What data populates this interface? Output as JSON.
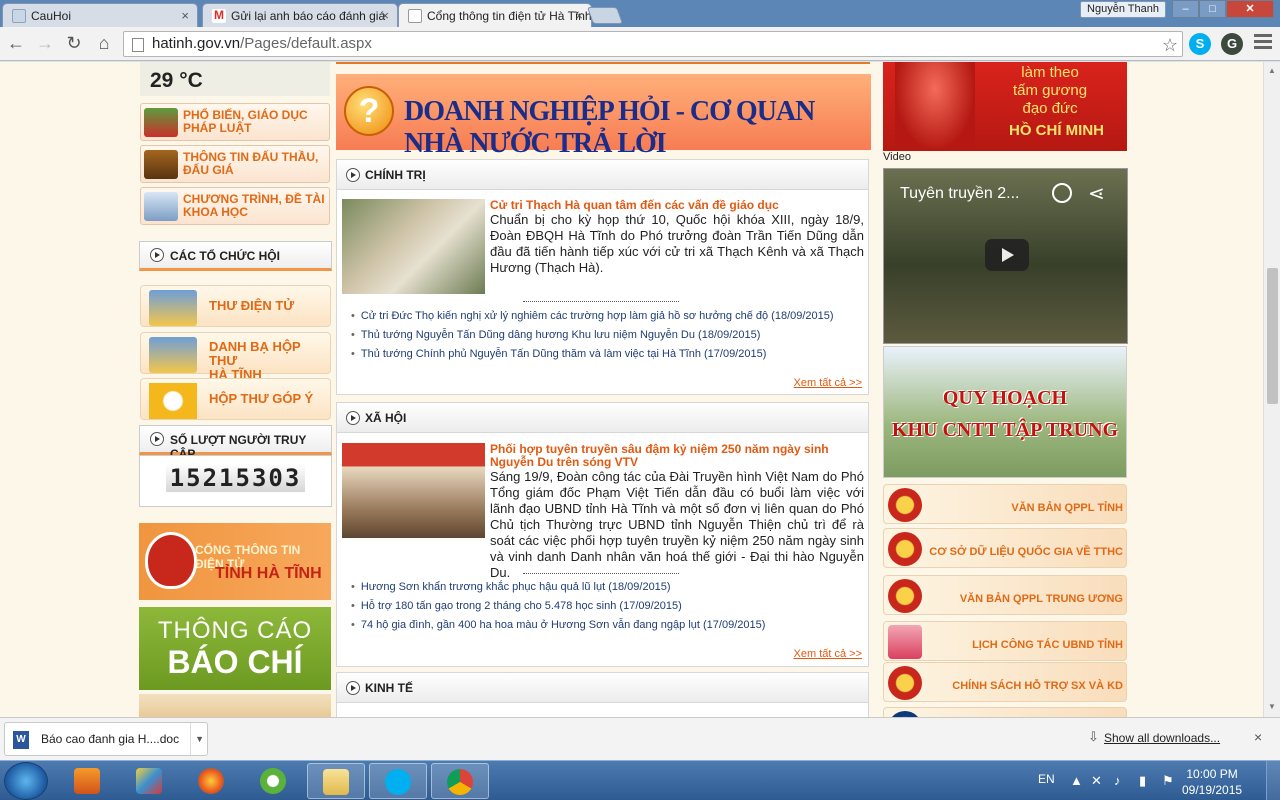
{
  "browser": {
    "tabs": [
      {
        "title": "CauHoi",
        "active": false
      },
      {
        "title": "Gửi lại anh báo cáo đánh giá",
        "active": false
      },
      {
        "title": "Cổng thông tin điện tử Hà Tĩnh",
        "active": true
      }
    ],
    "user": "Nguyễn Thanh",
    "url_host": "hatinh.gov.vn",
    "url_path": "/Pages/default.aspx"
  },
  "left": {
    "temperature": "29 °C",
    "links": [
      {
        "line1": "PHỔ BIẾN, GIÁO DỤC",
        "line2": "PHÁP LUẬT",
        "icon": "law-education-icon"
      },
      {
        "line1": "THÔNG TIN ĐẤU THẦU,",
        "line2": "ĐẤU GIÁ",
        "icon": "auction-gavel-icon"
      },
      {
        "line1": "CHƯƠNG TRÌNH, ĐỀ TÀI",
        "line2": "KHOA HỌC",
        "icon": "science-icon"
      }
    ],
    "org_header": "CÁC TỔ CHỨC HỘI",
    "mail_links": [
      {
        "line1": "THƯ ĐIỆN TỬ",
        "line2": ""
      },
      {
        "line1": "DANH BẠ HỘP THƯ",
        "line2": "HÀ TĨNH"
      },
      {
        "line1": "HỘP THƯ GÓP Ý",
        "line2": ""
      }
    ],
    "visits_header": "SỐ LƯỢT NGƯỜI TRUY CẬP",
    "visits_count": "15215303",
    "portal_banner": {
      "line1": "CỔNG THÔNG TIN ĐIỆN TỬ",
      "line2": "TỈNH HÀ TĨNH"
    },
    "press_banner": {
      "line1": "THÔNG CÁO",
      "line2": "BÁO CHÍ"
    }
  },
  "center": {
    "qa_banner": "DOANH NGHIỆP HỎI - CƠ QUAN NHÀ NƯỚC TRẢ LỜI",
    "sections": [
      {
        "title": "CHÍNH TRỊ",
        "lead_title": "Cử tri Thạch Hà quan tâm đến các vấn đề giáo dục",
        "lead_body": "Chuẩn bị cho kỳ họp thứ 10, Quốc hội khóa XIII, ngày 18/9, Đoàn ĐBQH Hà Tĩnh do Phó trưởng đoàn Trần Tiến Dũng dẫn đầu đã tiến hành tiếp xúc với cử tri xã Thạch Kênh và xã Thạch Hương (Thạch Hà).",
        "news": [
          "Cử tri Đức Thọ kiến nghị xử lý nghiêm các trường hợp làm giả hồ sơ hưởng chế độ (18/09/2015)",
          "Thủ tướng Nguyễn Tấn Dũng dâng hương Khu lưu niệm Nguyễn Du (18/09/2015)",
          "Thủ tướng Chính phủ Nguyễn Tấn Dũng thăm và làm việc tại Hà Tĩnh (17/09/2015)"
        ],
        "see_all": "Xem tất cả >>"
      },
      {
        "title": "XÃ HỘI",
        "lead_title": "Phối hợp tuyên truyền sâu đậm kỷ niệm 250 năm ngày sinh Nguyễn Du trên sóng VTV",
        "lead_body": "Sáng 19/9, Đoàn công tác của Đài Truyền hình Việt Nam do Phó Tổng giám đốc Phạm Việt Tiến dẫn đầu có buổi làm việc với lãnh đạo UBND tỉnh Hà Tĩnh và một số đơn vị liên quan do Phó Chủ tịch Thường trực UBND tỉnh Nguyễn Thiện chủ trì để rà soát các việc phối hợp tuyên truyền kỷ niệm 250 năm ngày sinh và vinh danh Danh nhân văn hoá thế giới - Đại thi hào Nguyễn Du.",
        "news": [
          "Hương Sơn khẩn trương khắc phục hậu quả lũ lụt (18/09/2015)",
          "Hỗ trợ 180 tấn gạo trong 2 tháng cho 5.478 học sinh (17/09/2015)",
          "74 hộ gia đình, gần 400 ha hoa màu ở Hương Sơn vẫn đang ngập lụt (17/09/2015)"
        ],
        "see_all": "Xem tất cả >>"
      },
      {
        "title": "KINH TẾ"
      }
    ]
  },
  "right": {
    "hcm_banner": {
      "lines": [
        "làm theo",
        "tấm gương",
        "đạo đức"
      ],
      "name": "HỒ CHÍ MINH"
    },
    "video_label": "Video",
    "video_title": "Tuyên truyền 2...",
    "plan_banner": {
      "line1": "QUY HOẠCH",
      "line2": "KHU CNTT TẬP TRUNG"
    },
    "links": [
      "VĂN BẢN QPPL TỈNH",
      "CƠ SỞ DỮ LIỆU QUỐC GIA VỀ TTHC",
      "VĂN BẢN QPPL TRUNG ƯƠNG",
      "LỊCH CÔNG TÁC UBND TỈNH",
      "CHÍNH SÁCH HỖ TRỢ SX VÀ KD"
    ]
  },
  "downloads": {
    "file": "Báo cao đanh gia H....doc",
    "show_all": "Show all downloads...",
    "close": "×"
  },
  "taskbar": {
    "lang": "EN",
    "time": "10:00 PM",
    "date": "09/19/2015"
  },
  "colors": {
    "accent": "#e06a16",
    "section_link": "#e25a12",
    "tabstrip": "#5b86b5",
    "taskbar": "#2e5b92"
  }
}
